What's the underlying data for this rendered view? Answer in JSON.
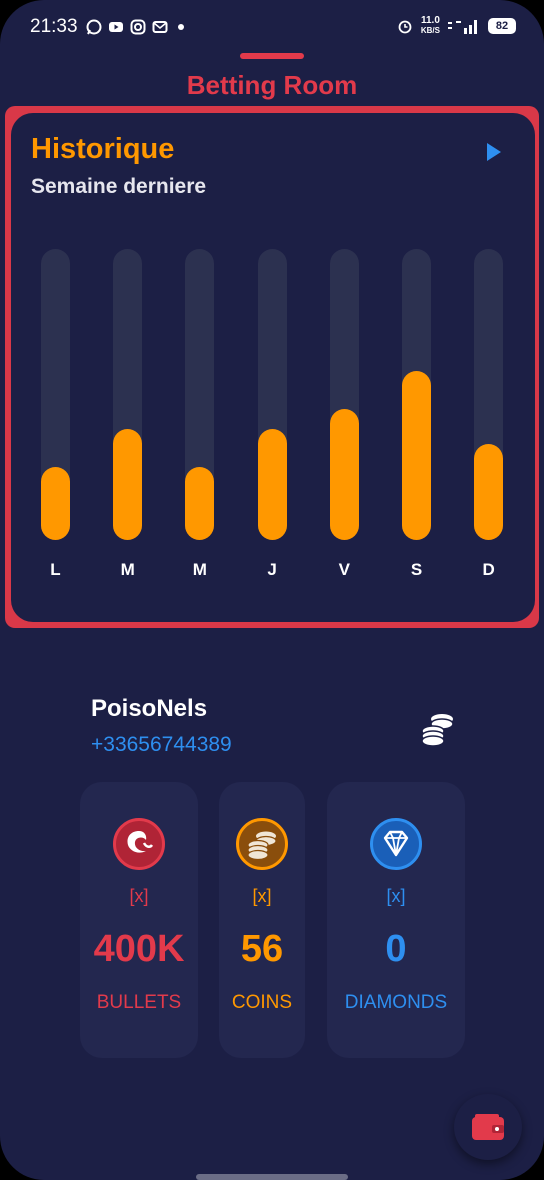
{
  "status_bar": {
    "time": "21:33",
    "speed_value": "11.0",
    "speed_unit": "KB/S",
    "battery": "82"
  },
  "header": {
    "title": "Betting Room"
  },
  "history": {
    "title": "Historique",
    "subtitle": "Semaine derniere",
    "chart_data": {
      "type": "bar",
      "categories": [
        "L",
        "M",
        "M",
        "J",
        "V",
        "S",
        "D"
      ],
      "values": [
        25,
        38,
        25,
        38,
        45,
        58,
        33
      ],
      "ylim": [
        0,
        100
      ]
    }
  },
  "user": {
    "name": "PoisoNels",
    "phone": "+33656744389"
  },
  "stats": [
    {
      "placeholder": "[x]",
      "value": "400K",
      "label": "BULLETS",
      "color": "#e23a4b",
      "icon": "bullet-icon"
    },
    {
      "placeholder": "[x]",
      "value": "56",
      "label": "COINS",
      "color": "#ff9800",
      "icon": "coins-icon"
    },
    {
      "placeholder": "[x]",
      "value": "0",
      "label": "DIAMONDS",
      "color": "#2e8ff0",
      "icon": "diamond-icon"
    }
  ],
  "colors": {
    "background": "#1c1f45",
    "accent_red": "#e23a4b",
    "accent_orange": "#ff9800",
    "accent_blue": "#2e8ff0"
  }
}
